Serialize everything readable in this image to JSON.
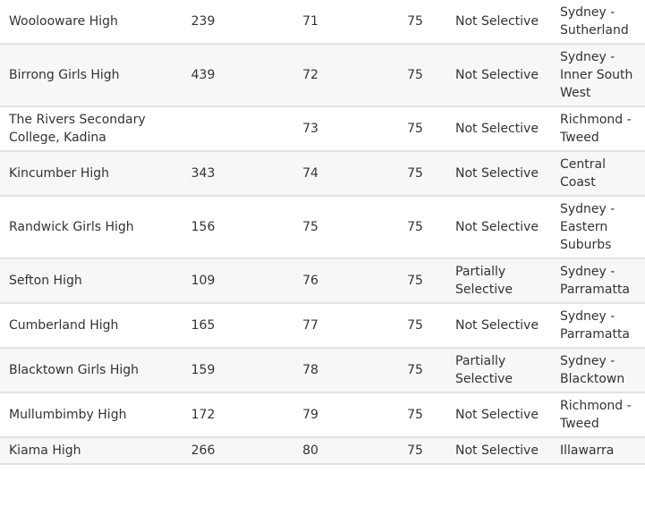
{
  "rows": [
    {
      "name": "Woolooware High",
      "c1": "239",
      "c2": "71",
      "c3": "75",
      "sel": "Not Selective",
      "region": "Sydney - Sutherland"
    },
    {
      "name": "Birrong Girls High",
      "c1": "439",
      "c2": "72",
      "c3": "75",
      "sel": "Not Selective",
      "region": "Sydney - Inner South West"
    },
    {
      "name": "The Rivers Secondary College, Kadina",
      "c1": "",
      "c2": "73",
      "c3": "75",
      "sel": "Not Selective",
      "region": "Richmond - Tweed"
    },
    {
      "name": "Kincumber High",
      "c1": "343",
      "c2": "74",
      "c3": "75",
      "sel": "Not Selective",
      "region": "Central Coast"
    },
    {
      "name": "Randwick Girls High",
      "c1": "156",
      "c2": "75",
      "c3": "75",
      "sel": "Not Selective",
      "region": "Sydney - Eastern Suburbs"
    },
    {
      "name": "Sefton High",
      "c1": "109",
      "c2": "76",
      "c3": "75",
      "sel": "Partially Selective",
      "region": "Sydney - Parramatta"
    },
    {
      "name": "Cumberland High",
      "c1": "165",
      "c2": "77",
      "c3": "75",
      "sel": "Not Selective",
      "region": "Sydney - Parramatta"
    },
    {
      "name": "Blacktown Girls High",
      "c1": "159",
      "c2": "78",
      "c3": "75",
      "sel": "Partially Selective",
      "region": "Sydney - Blacktown"
    },
    {
      "name": "Mullumbimby High",
      "c1": "172",
      "c2": "79",
      "c3": "75",
      "sel": "Not Selective",
      "region": "Richmond - Tweed"
    },
    {
      "name": "Kiama High",
      "c1": "266",
      "c2": "80",
      "c3": "75",
      "sel": "Not Selective",
      "region": "Illawarra"
    }
  ]
}
